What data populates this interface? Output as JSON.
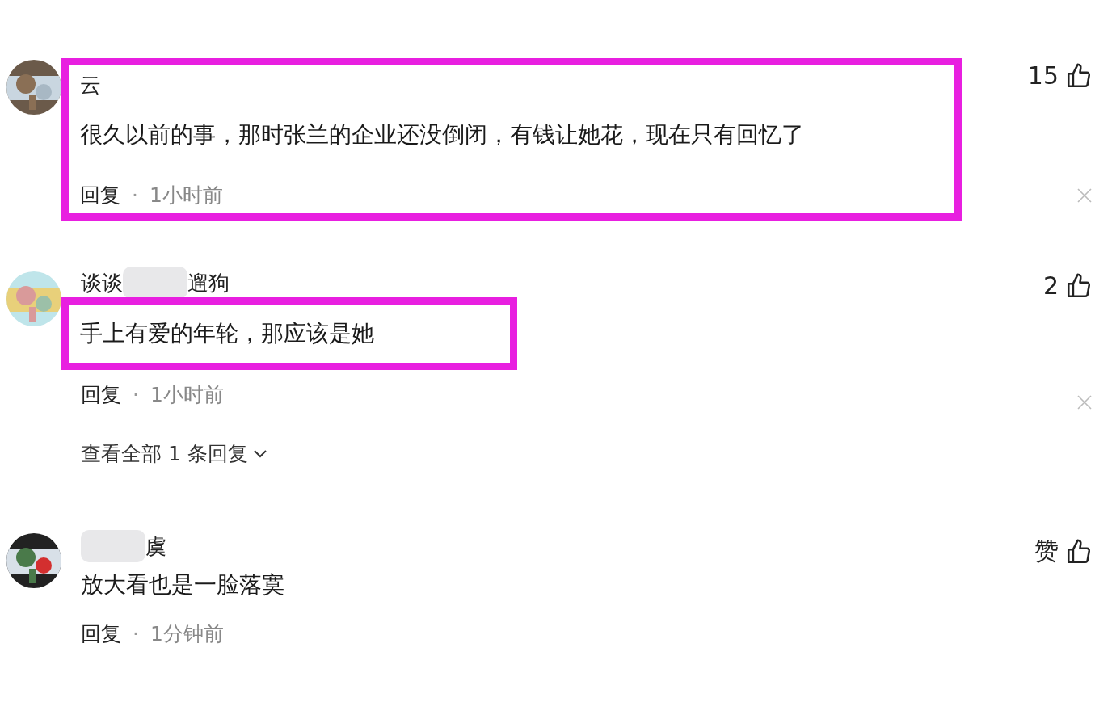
{
  "comments": [
    {
      "avatar": {
        "kind": "picture"
      },
      "name": [
        {
          "kind": "text",
          "text": "云"
        }
      ],
      "text": "很久以前的事，那时张兰的企业还没倒闭，有钱让她花，现在只有回忆了",
      "reply": "回复",
      "separator": "·",
      "time": "1小时前",
      "likes": "15",
      "highlight": {
        "name": true,
        "text": true,
        "meta": true
      },
      "dismissible": true
    },
    {
      "avatar": {
        "kind": "picture"
      },
      "name": [
        {
          "kind": "text",
          "text": "谈谈"
        },
        {
          "kind": "blur"
        },
        {
          "kind": "text",
          "text": "遛狗"
        }
      ],
      "text": "手上有爱的年轮，那应该是她",
      "reply": "回复",
      "separator": "·",
      "time": "1小时前",
      "likes": "2",
      "highlight": {
        "name": false,
        "text": true,
        "meta": false
      },
      "dismissible": true,
      "more_replies": "查看全部 1 条回复"
    },
    {
      "avatar": {
        "kind": "picture"
      },
      "name": [
        {
          "kind": "blur"
        },
        {
          "kind": "text",
          "text": "虞"
        }
      ],
      "text": "放大看也是一脸落寞",
      "reply": "回复",
      "separator": "·",
      "time": "1分钟前",
      "likes": "赞",
      "highlight": {
        "name": false,
        "text": false,
        "meta": false
      },
      "dismissible": false
    }
  ]
}
